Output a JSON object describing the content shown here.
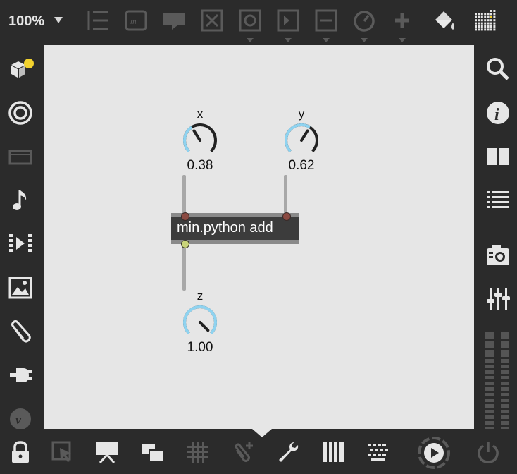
{
  "toolbar": {
    "zoom": "100%",
    "icons": [
      "bpatcher-icon",
      "comment-icon",
      "message-icon",
      "toggle-icon",
      "button-icon",
      "number-icon",
      "slider-icon",
      "dial-icon",
      "add-object-icon",
      "paint-bucket-icon",
      "grid-palette-icon"
    ]
  },
  "left_sidebar": {
    "icons": [
      "packages-icon",
      "target-icon",
      "browser-icon",
      "music-note-icon",
      "media-icon",
      "image-icon",
      "paperclip-icon",
      "plug-icon",
      "vimeo-icon"
    ]
  },
  "right_sidebar": {
    "icons": [
      "search-icon",
      "info-icon",
      "book-icon",
      "list-icon",
      "snapshot-icon",
      "mixer-icon"
    ]
  },
  "bottom_bar": {
    "icons": [
      "lock-icon",
      "select-icon",
      "presentation-icon",
      "windows-icon",
      "grid-icon",
      "autoconnect-icon",
      "wrench-icon",
      "piano-icon",
      "keyboard-icon",
      "play-icon",
      "power-icon"
    ]
  },
  "patch": {
    "knob_x": {
      "label": "x",
      "value": "0.38",
      "level": 0.38
    },
    "knob_y": {
      "label": "y",
      "value": "0.62",
      "level": 0.62
    },
    "knob_z": {
      "label": "z",
      "value": "1.00",
      "level": 1.0
    },
    "object_text": "min.python add"
  },
  "colors": {
    "background": "#2b2b2b",
    "canvas": "#e6e6e6",
    "knob_arc": "#8fd3f0",
    "badge": "#f2d22e"
  }
}
